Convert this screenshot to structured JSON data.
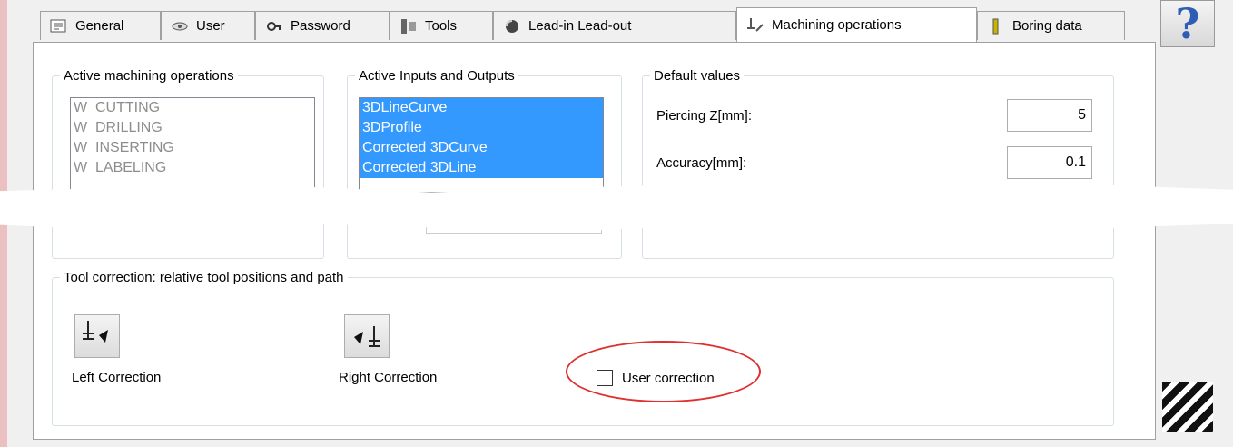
{
  "tabs": [
    {
      "label": "General",
      "icon": "general-icon"
    },
    {
      "label": "User",
      "icon": "user-icon"
    },
    {
      "label": "Password",
      "icon": "password-icon"
    },
    {
      "label": "Tools",
      "icon": "tools-icon"
    },
    {
      "label": "Lead-in Lead-out",
      "icon": "lead-in-icon"
    },
    {
      "label": "Machining operations",
      "icon": "machining-icon"
    },
    {
      "label": "Boring data",
      "icon": "boring-icon"
    }
  ],
  "active_tab": "Machining operations",
  "help_button": {
    "label": "?"
  },
  "active_ops": {
    "legend": "Active machining operations",
    "items": [
      "W_CUTTING",
      "W_DRILLING",
      "W_INSERTING",
      "W_LABELING"
    ]
  },
  "io": {
    "legend": "Active Inputs and Outputs",
    "items": [
      "3DLineCurve",
      "3DProfile",
      "Corrected 3DCurve",
      "Corrected 3DLine"
    ]
  },
  "defaults": {
    "legend": "Default values",
    "piercing_label": "Piercing Z[mm]:",
    "piercing_value": "5",
    "accuracy_label": "Accuracy[mm]:",
    "accuracy_value": "0.1"
  },
  "tool_correction": {
    "legend": "Tool correction: relative tool positions and path",
    "left_label": "Left Correction",
    "right_label": "Right Correction",
    "user_label": "User correction",
    "user_checked": false
  },
  "colors": {
    "selection": "#3399ff",
    "annotation": "#e0302e",
    "help_question": "#2d5db4"
  }
}
